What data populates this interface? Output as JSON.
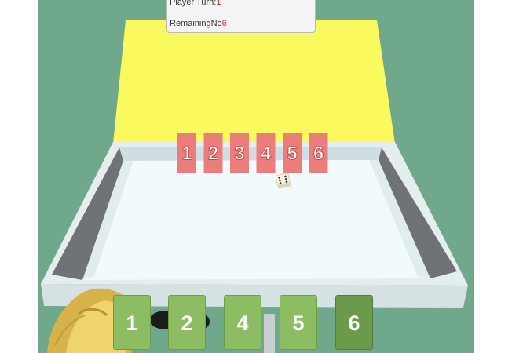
{
  "hud": {
    "player_turn_label": "Player Turn:",
    "player_turn_value": "1",
    "remaining_label": "RemainingNo",
    "remaining_value": "6"
  },
  "board_cards": [
    "1",
    "2",
    "3",
    "4",
    "5",
    "6"
  ],
  "hand_tiles": [
    {
      "label": "1",
      "selected": false
    },
    {
      "label": "2",
      "selected": false
    },
    {
      "label": "4",
      "selected": false
    },
    {
      "label": "5",
      "selected": false
    },
    {
      "label": "6",
      "selected": true
    }
  ],
  "dice": {
    "face": 6
  },
  "colors": {
    "background": "#6fa88b",
    "lid": "#fafa5e",
    "board_card": "#ec7d7d",
    "tile": "#8cbd63",
    "tile_selected": "#6b9a4a",
    "hud_value": "#e0302a"
  }
}
